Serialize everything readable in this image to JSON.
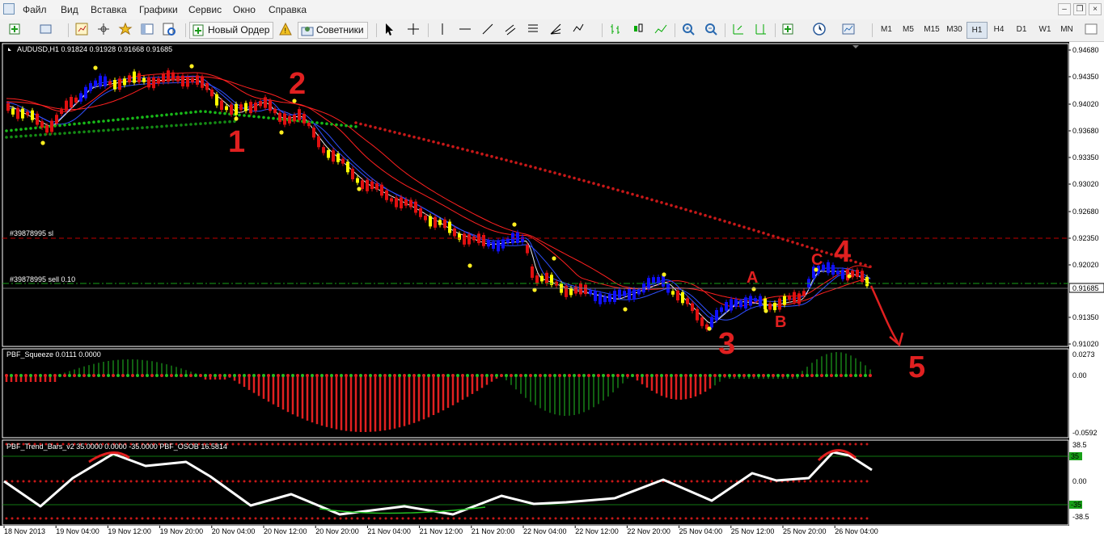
{
  "menu": {
    "items": [
      "Файл",
      "Вид",
      "Вставка",
      "Графики",
      "Сервис",
      "Окно",
      "Справка"
    ]
  },
  "toolbar": {
    "new_order_label": "Новый Ордер",
    "advisors_label": "Советники",
    "timeframes": [
      "M1",
      "M5",
      "M15",
      "M30",
      "H1",
      "H4",
      "D1",
      "W1",
      "MN"
    ],
    "active_timeframe": "H1"
  },
  "main_chart": {
    "header": "AUDUSD,H1  0.91824 0.91928 0.91668 0.91685",
    "current_price": "0.91685",
    "sl_line_label": "#39878995 sl",
    "order_line_label": "#39878995 sell 0.10",
    "price_ticks": [
      "0.94680",
      "0.94350",
      "0.94020",
      "0.93680",
      "0.93350",
      "0.93020",
      "0.92680",
      "0.92350",
      "0.92020",
      "0.91685",
      "0.91350",
      "0.91020"
    ],
    "wave_labels": [
      "1",
      "2",
      "3",
      "4",
      "5",
      "A",
      "B",
      "C"
    ]
  },
  "squeeze_panel": {
    "header": "PBF_Squeeze 0.0111 0.0000",
    "ticks": [
      "0.0273",
      "0.00",
      "-0.0592"
    ]
  },
  "trend_panel": {
    "header": "PBF_Trend_Bars_v2 35.0000 0.0000 -35.0000  PBF_OSOB 16.5814",
    "ticks": [
      "38.5",
      "0.00",
      "-38.5"
    ],
    "level_tags": [
      "35",
      "-35"
    ]
  },
  "time_axis": {
    "labels": [
      "18 Nov 2013",
      "19 Nov 04:00",
      "19 Nov 12:00",
      "19 Nov 20:00",
      "20 Nov 04:00",
      "20 Nov 12:00",
      "20 Nov 20:00",
      "21 Nov 04:00",
      "21 Nov 12:00",
      "21 Nov 20:00",
      "22 Nov 04:00",
      "22 Nov 12:00",
      "22 Nov 20:00",
      "25 Nov 04:00",
      "25 Nov 12:00",
      "25 Nov 20:00",
      "26 Nov 04:00"
    ]
  },
  "colors": {
    "background": "#000000",
    "bull_candle": "#1010ff",
    "bear_candle": "#e01010",
    "neutral_candle": "#ffff00",
    "ma_red": "#ff2020",
    "ma_blue": "#3050ff",
    "dots_green": "#18b818",
    "dots_red": "#c81818",
    "hist_green": "#22c022",
    "hist_red": "#e02020",
    "annotation_red": "#e02020"
  }
}
